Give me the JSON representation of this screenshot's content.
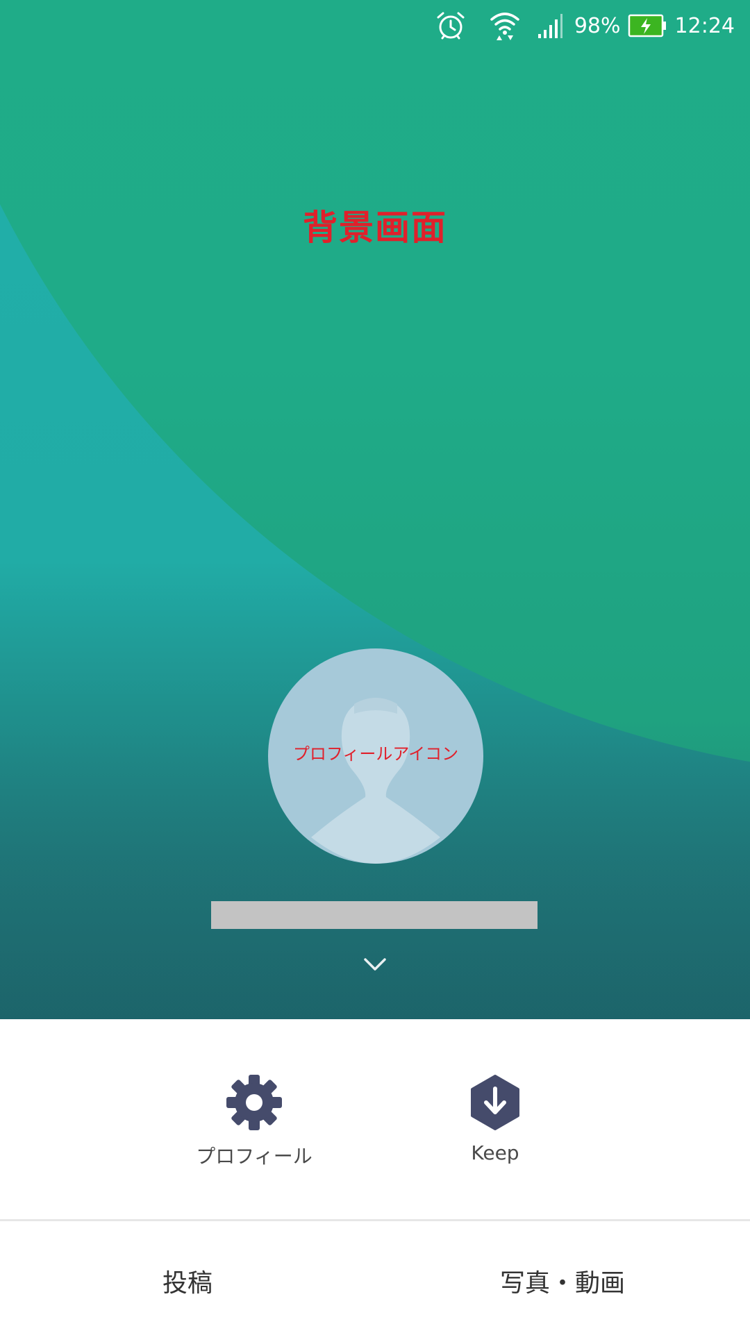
{
  "status_bar": {
    "icons": [
      "alarm-icon",
      "wifi-icon",
      "signal-icon",
      "battery-charging-icon"
    ],
    "battery_percent": "98%",
    "time": "12:24",
    "battery_color": "#3cb521"
  },
  "cover": {
    "annotation": "背景画面",
    "colors": {
      "primary": "#1fae8a",
      "secondary": "#21afa9",
      "annotation": "#e0202b"
    }
  },
  "profile": {
    "avatar_annotation": "プロフィールアイコン",
    "name": "",
    "name_redacted": true
  },
  "actions": [
    {
      "label": "プロフィール",
      "icon": "gear-icon"
    },
    {
      "label": "Keep",
      "icon": "keep-download-icon"
    }
  ],
  "tabs": [
    {
      "label": "投稿"
    },
    {
      "label": "写真・動画"
    }
  ],
  "accent_color": "#454b6b"
}
